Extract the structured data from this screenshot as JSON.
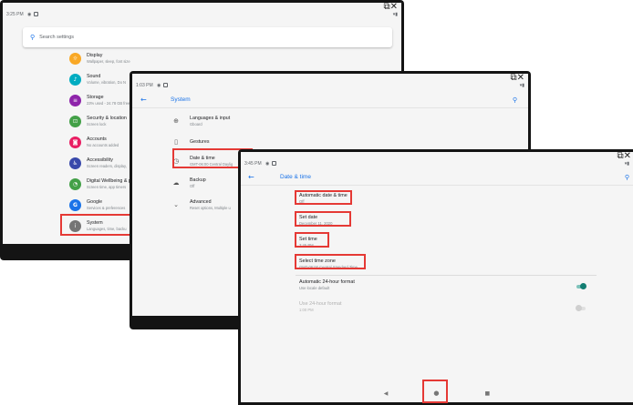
{
  "colors": {
    "accent": "#1a73e8",
    "highlight": "#e53935",
    "toggle_on": "#137d72"
  },
  "screen1": {
    "status_time": "3:25 PM",
    "search_placeholder": "Search settings",
    "items": [
      {
        "title": "Display",
        "subtitle": "Wallpaper, sleep, font size",
        "color": "#f9a825",
        "icon": "display-icon",
        "glyph": "☼"
      },
      {
        "title": "Sound",
        "subtitle": "Volume, vibration, Do N",
        "color": "#00acc1",
        "icon": "sound-icon",
        "glyph": "♪"
      },
      {
        "title": "Storage",
        "subtitle": "23% used - 24.78 GB free",
        "color": "#8e24aa",
        "icon": "storage-icon",
        "glyph": "≡"
      },
      {
        "title": "Security & location",
        "subtitle": "Screen lock",
        "color": "#43a047",
        "icon": "lock-icon",
        "glyph": "⊡"
      },
      {
        "title": "Accounts",
        "subtitle": "No accounts added",
        "color": "#e91e63",
        "icon": "accounts-icon",
        "glyph": "◙"
      },
      {
        "title": "Accessibility",
        "subtitle": "Screen readers, display,",
        "color": "#3949ab",
        "icon": "accessibility-icon",
        "glyph": "♿"
      },
      {
        "title": "Digital Wellbeing & p",
        "subtitle": "Screen time, app timers",
        "color": "#43a047",
        "icon": "wellbeing-icon",
        "glyph": "◔"
      },
      {
        "title": "Google",
        "subtitle": "Services & preferences",
        "color": "#1a73e8",
        "icon": "google-icon",
        "glyph": "G"
      },
      {
        "title": "System",
        "subtitle": "Languages, time, backu",
        "color": "#757575",
        "icon": "info-icon",
        "glyph": "i"
      }
    ]
  },
  "screen2": {
    "status_time": "1:03 PM",
    "title": "System",
    "items": [
      {
        "title": "Languages & input",
        "subtitle": "Gboard",
        "icon": "globe-icon",
        "glyph": "⊕"
      },
      {
        "title": "Gestures",
        "subtitle": "",
        "icon": "gestures-icon",
        "glyph": "▯"
      },
      {
        "title": "Date & time",
        "subtitle": "GMT-06:00 Central Daylig",
        "icon": "clock-icon",
        "glyph": "◷"
      },
      {
        "title": "Backup",
        "subtitle": "Off",
        "icon": "backup-icon",
        "glyph": "☁"
      },
      {
        "title": "Advanced",
        "subtitle": "Reset options, Multiple u",
        "icon": "chevron-down-icon",
        "glyph": "⌄"
      }
    ]
  },
  "screen3": {
    "status_time": "3:45 PM",
    "title": "Date & time",
    "rows": [
      {
        "title": "Automatic date & time",
        "subtitle": "Off"
      },
      {
        "title": "Set date",
        "subtitle": "December 11, 2020"
      },
      {
        "title": "Set time",
        "subtitle": "3:45 PM"
      },
      {
        "title": "Select time zone",
        "subtitle": "GMT-06:00 Central Standard Time"
      },
      {
        "title": "Automatic 24-hour format",
        "subtitle": "Use locale default"
      },
      {
        "title": "Use 24-hour format",
        "subtitle": "1:00 PM"
      }
    ],
    "toggle_24h_auto": true,
    "toggle_24h": false
  }
}
